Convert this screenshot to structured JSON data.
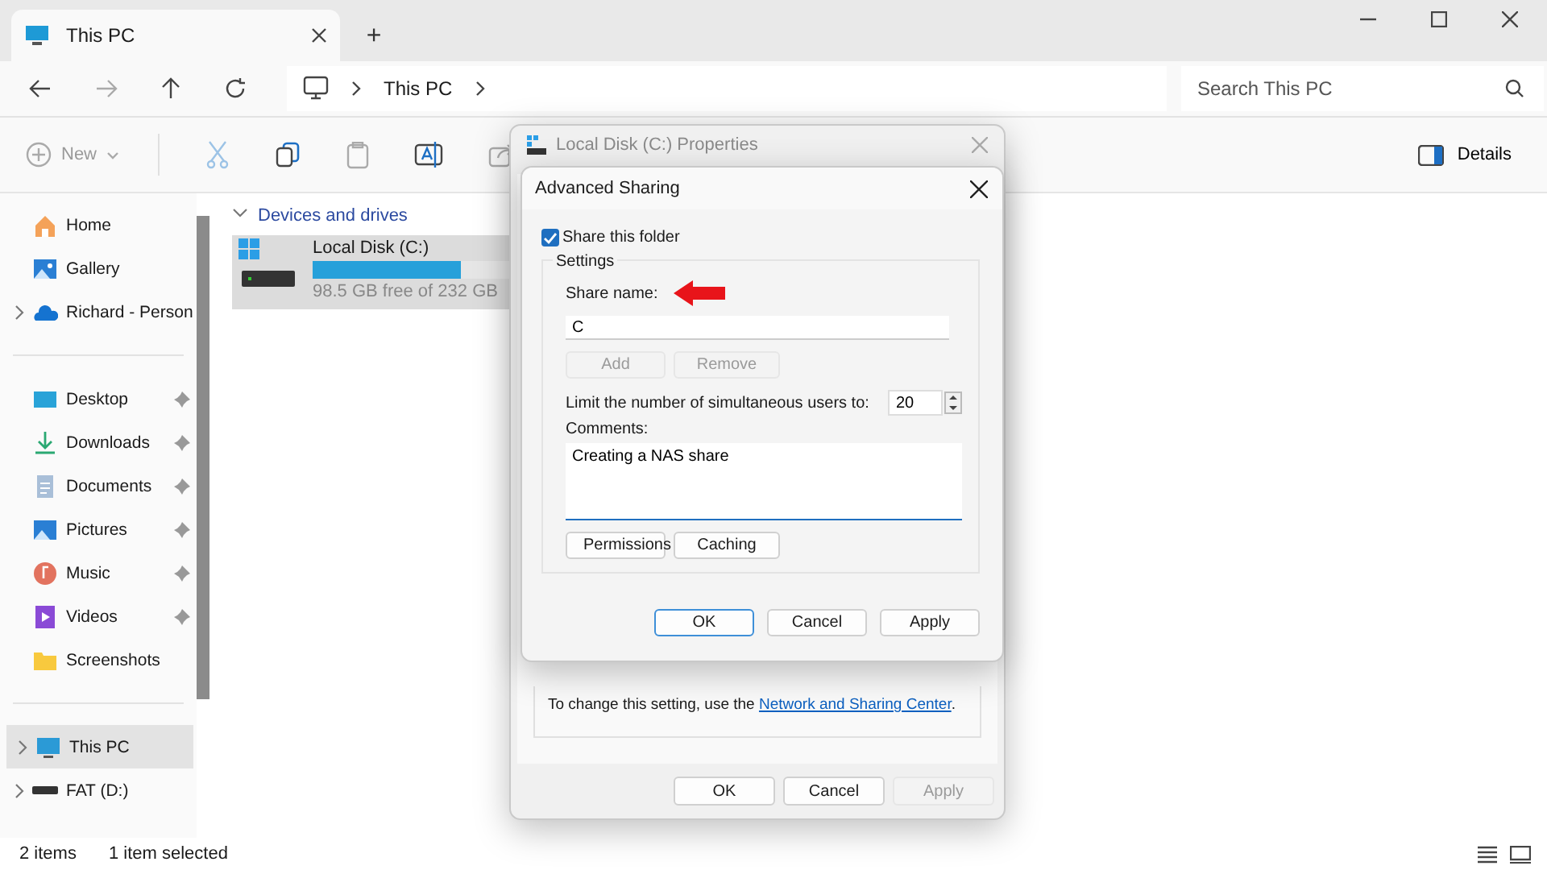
{
  "window": {
    "tab_title": "This PC",
    "new_tab": "+"
  },
  "address": {
    "path": [
      "This PC"
    ]
  },
  "search": {
    "placeholder": "Search This PC"
  },
  "toolbar": {
    "new": "New",
    "details": "Details"
  },
  "sidebar": {
    "groups": [
      [
        {
          "label": "Home",
          "kind": "home",
          "expandable": false,
          "pinned": false,
          "selected": false
        },
        {
          "label": "Gallery",
          "kind": "gallery",
          "expandable": false,
          "pinned": false,
          "selected": false
        },
        {
          "label": "Richard - Person",
          "kind": "cloud",
          "expandable": true,
          "pinned": false,
          "selected": false
        }
      ],
      [
        {
          "label": "Desktop",
          "kind": "desktop",
          "expandable": false,
          "pinned": true,
          "selected": false
        },
        {
          "label": "Downloads",
          "kind": "downloads",
          "expandable": false,
          "pinned": true,
          "selected": false
        },
        {
          "label": "Documents",
          "kind": "documents",
          "expandable": false,
          "pinned": true,
          "selected": false
        },
        {
          "label": "Pictures",
          "kind": "pictures",
          "expandable": false,
          "pinned": true,
          "selected": false
        },
        {
          "label": "Music",
          "kind": "music",
          "expandable": false,
          "pinned": true,
          "selected": false
        },
        {
          "label": "Videos",
          "kind": "videos",
          "expandable": false,
          "pinned": true,
          "selected": false
        },
        {
          "label": "Screenshots",
          "kind": "folder",
          "expandable": false,
          "pinned": false,
          "selected": false
        }
      ],
      [
        {
          "label": "This PC",
          "kind": "pc",
          "expandable": true,
          "pinned": false,
          "selected": true
        },
        {
          "label": "FAT (D:)",
          "kind": "drive",
          "expandable": true,
          "pinned": false,
          "selected": false
        }
      ]
    ]
  },
  "content": {
    "section": "Devices and drives",
    "expanded": true,
    "drives": [
      {
        "name": "Local Disk (C:)",
        "level": 0.575,
        "free": "98.5 GB free of 232 GB",
        "selected": true
      }
    ]
  },
  "status_bar": {
    "count": "2 items",
    "selection": "1 item selected"
  },
  "properties_dialog": {
    "title": "Local Disk (C:) Properties",
    "note": "To change this setting, use the ",
    "link": "Network and Sharing Center",
    "note_end": ".",
    "buttons": [
      {
        "label": "OK",
        "disabled": false
      },
      {
        "label": "Cancel",
        "disabled": false
      },
      {
        "label": "Apply",
        "disabled": true
      }
    ]
  },
  "sharing_dialog": {
    "title": "Advanced Sharing",
    "share": {
      "label": "Share this folder",
      "checked": true
    },
    "group": "Settings",
    "share_name_label": "Share name:",
    "share_name": "C",
    "name_buttons": [
      {
        "label": "Add",
        "disabled": true
      },
      {
        "label": "Remove",
        "disabled": true
      }
    ],
    "limit_label": "Limit the number of simultaneous users to:",
    "users": "20",
    "comments_label": "Comments:",
    "comments": "Creating a NAS share",
    "option_buttons": [
      {
        "label": "Permissions",
        "disabled": false
      },
      {
        "label": "Caching",
        "disabled": false
      }
    ],
    "buttons": [
      {
        "label": "OK",
        "default": true
      },
      {
        "label": "Cancel",
        "default": false
      },
      {
        "label": "Apply",
        "default": false
      }
    ]
  }
}
